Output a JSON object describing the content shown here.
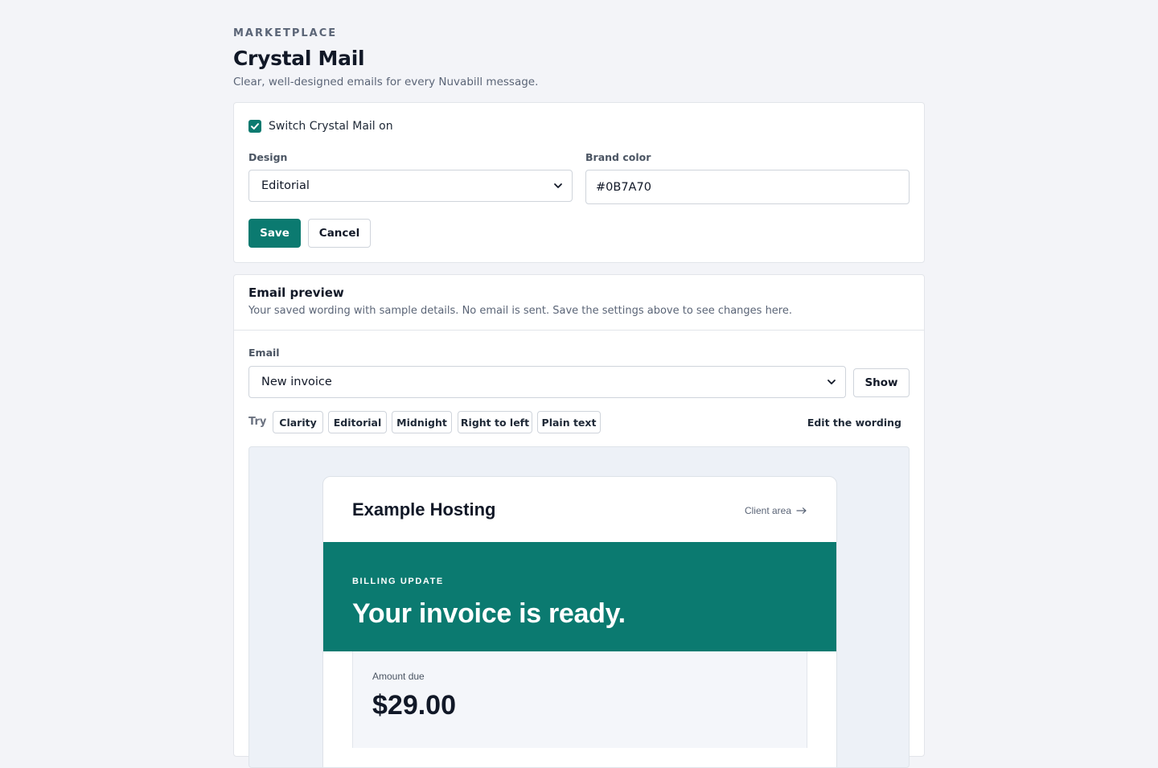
{
  "header": {
    "eyebrow": "MARKETPLACE",
    "title": "Crystal Mail",
    "subtitle": "Clear, well-designed emails for every Nuvabill message."
  },
  "settings": {
    "enable_label": "Switch Crystal Mail on",
    "enabled": true,
    "design_label": "Design",
    "design_value": "Editorial",
    "brand_color_label": "Brand color",
    "brand_color_value": "#0B7A70",
    "save_label": "Save",
    "cancel_label": "Cancel"
  },
  "preview": {
    "title": "Email preview",
    "description": "Your saved wording with sample details. No email is sent. Save the settings above to see changes here.",
    "email_label": "Email",
    "email_value": "New invoice",
    "show_label": "Show",
    "try_label": "Try",
    "chips": [
      "Clarity",
      "Editorial",
      "Midnight",
      "Right to left",
      "Plain text"
    ],
    "edit_wording_label": "Edit the wording"
  },
  "email": {
    "brand": "Example Hosting",
    "client_area": "Client area",
    "hero_eyebrow": "BILLING UPDATE",
    "hero_title": "Your invoice is ready.",
    "amount_label": "Amount due",
    "amount_value": "$29.00"
  },
  "colors": {
    "accent": "#0B7A70",
    "background": "#F3F4F8"
  }
}
